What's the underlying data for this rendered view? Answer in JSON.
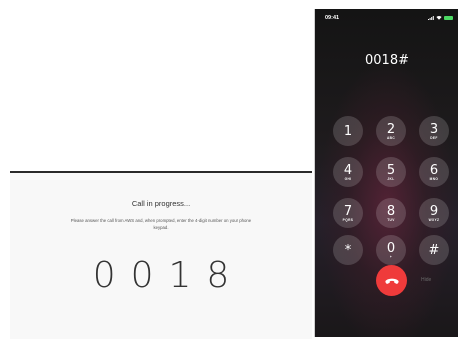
{
  "web": {
    "title": "Call in progress...",
    "instructions": "Please answer the call from AWS and, when prompted, enter the 4-digit number on your phone keypad.",
    "code": "0018"
  },
  "phone": {
    "status": {
      "time": "09:41",
      "battery_color": "#4cd964"
    },
    "dialed_number": "0018#",
    "keys": [
      {
        "digit": "1",
        "letters": ""
      },
      {
        "digit": "2",
        "letters": "ABC"
      },
      {
        "digit": "3",
        "letters": "DEF"
      },
      {
        "digit": "4",
        "letters": "GHI"
      },
      {
        "digit": "5",
        "letters": "JKL"
      },
      {
        "digit": "6",
        "letters": "MNO"
      },
      {
        "digit": "7",
        "letters": "PQRS"
      },
      {
        "digit": "8",
        "letters": "TUV"
      },
      {
        "digit": "9",
        "letters": "WXYZ"
      },
      {
        "digit": "*",
        "letters": ""
      },
      {
        "digit": "0",
        "letters": "+"
      },
      {
        "digit": "#",
        "letters": ""
      }
    ],
    "end_call_color": "#ef3b3b",
    "end_call_icon": "phone-hangup-icon",
    "hide_label": "Hide"
  }
}
